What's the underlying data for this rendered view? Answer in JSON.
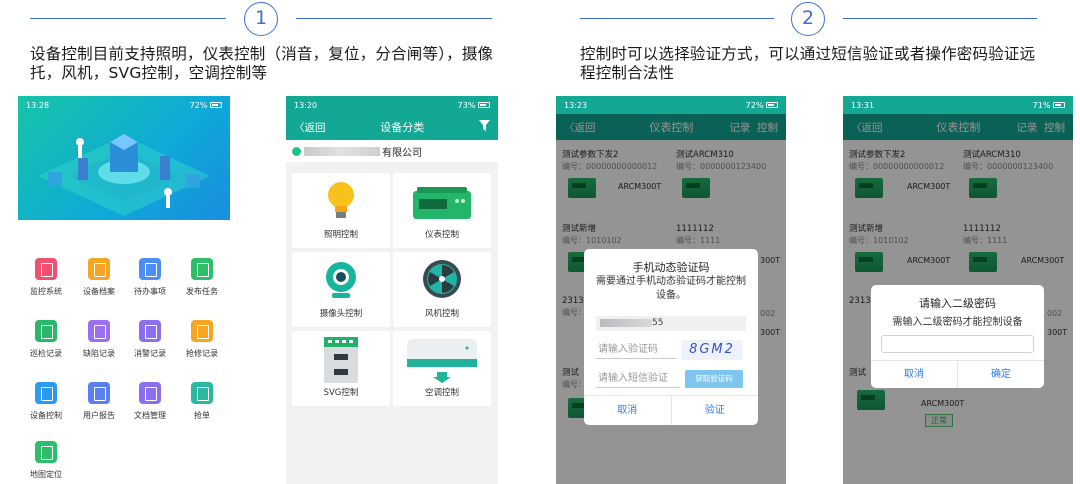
{
  "steps": [
    {
      "number": "1",
      "description": "设备控制目前支持照明，仪表控制（消音，复位，分合闸等），摄像托，风机，SVG控制，空调控制等"
    },
    {
      "number": "2",
      "description": "控制时可以选择验证方式，可以通过短信验证或者操作密码验证远程控制合法性"
    }
  ],
  "phone1": {
    "status_time": "13:28",
    "status_right": "72%",
    "tiles": [
      {
        "label": "监控系统",
        "icon": "monitor-icon",
        "color": "#f0506e"
      },
      {
        "label": "设备档案",
        "icon": "archive-icon",
        "color": "#f6a623"
      },
      {
        "label": "待办事项",
        "icon": "todo-icon",
        "color": "#4c8df6"
      },
      {
        "label": "发布任务",
        "icon": "task-icon",
        "color": "#2bbf6a"
      },
      {
        "label": "巡检记录",
        "icon": "inspect-icon",
        "color": "#27b86a"
      },
      {
        "label": "缺陷记录",
        "icon": "defect-icon",
        "color": "#9a6ff2"
      },
      {
        "label": "消警记录",
        "icon": "alarm-icon",
        "color": "#8c6ff0"
      },
      {
        "label": "抢修记录",
        "icon": "repair-icon",
        "color": "#f6a623"
      },
      {
        "label": "设备控制",
        "icon": "control-icon",
        "color": "#2b9af0"
      },
      {
        "label": "用户报告",
        "icon": "report-icon",
        "color": "#5a7ff2"
      },
      {
        "label": "文档管理",
        "icon": "folder-icon",
        "color": "#8b6ff2"
      },
      {
        "label": "抢单",
        "icon": "grab-icon",
        "color": "#2ab9a0"
      },
      {
        "label": "地图定位",
        "icon": "map-icon",
        "color": "#2bbf6a"
      }
    ]
  },
  "phone2": {
    "status_time": "13:20",
    "status_right": "73%",
    "back": "返回",
    "title": "设备分类",
    "company_suffix": "有限公司",
    "categories": [
      {
        "label": "照明控制",
        "icon": "bulb-icon"
      },
      {
        "label": "仪表控制",
        "icon": "meter-icon"
      },
      {
        "label": "摄像头控制",
        "icon": "camera-icon"
      },
      {
        "label": "风机控制",
        "icon": "fan-icon"
      },
      {
        "label": "SVG控制",
        "icon": "svg-cabinet-icon"
      },
      {
        "label": "空调控制",
        "icon": "aircon-icon"
      }
    ]
  },
  "phone3": {
    "status_time": "13:23",
    "status_right": "72%",
    "back": "返回",
    "title": "仪表控制",
    "right_actions": "记录  控制",
    "cards": [
      {
        "title": "测试参数下发2",
        "code": "编号：00000000000012",
        "model": "ARCM300T"
      },
      {
        "title": "测试ARCM310",
        "code": "编号：0000000123400",
        "model": ""
      },
      {
        "title": "测试新增",
        "code": "编号：1010102",
        "model": ""
      },
      {
        "title": "1111112",
        "code": "编号：1111",
        "model": "300T"
      },
      {
        "title": "2313",
        "code": "编号：",
        "model": ""
      },
      {
        "title": "",
        "code": "002",
        "model": "300T"
      },
      {
        "title": "测试",
        "code": "编号：",
        "model": ""
      }
    ],
    "dialog": {
      "title": "手机动态验证码",
      "message": "需要通过手机动态验证码才能控制设备。",
      "phone_suffix": "55",
      "code_placeholder": "请输入验证码",
      "captcha": "8GM2",
      "sms_placeholder": "请输入短信验证",
      "get_code": "获取验证码",
      "cancel": "取消",
      "confirm": "验证"
    }
  },
  "phone4": {
    "status_time": "13:31",
    "status_right": "71%",
    "back": "返回",
    "title": "仪表控制",
    "right_actions": "记录  控制",
    "cards": [
      {
        "title": "测试参数下发2",
        "code": "编号：00000000000012",
        "model": "ARCM300T"
      },
      {
        "title": "测试ARCM310",
        "code": "编号：0000000123400",
        "model": ""
      },
      {
        "title": "测试新增",
        "code": "编号：1010102",
        "model": "ARCM300T"
      },
      {
        "title": "1111112",
        "code": "编号：1111",
        "model": "ARCM300T"
      },
      {
        "title": "2313",
        "code": "",
        "model": ""
      },
      {
        "title": "",
        "code": "002",
        "model": "300T"
      },
      {
        "title": "测试",
        "code": "",
        "model": "ARCM300T"
      }
    ],
    "status_badge": "正常",
    "dialog": {
      "title": "请输入二级密码",
      "message": "需输入二级密码才能控制设备",
      "cancel": "取消",
      "confirm": "确定"
    }
  },
  "colors": {
    "accent": "#3b6fd6",
    "teal": "#12a894",
    "dialog_button": "#2f7ee6"
  }
}
